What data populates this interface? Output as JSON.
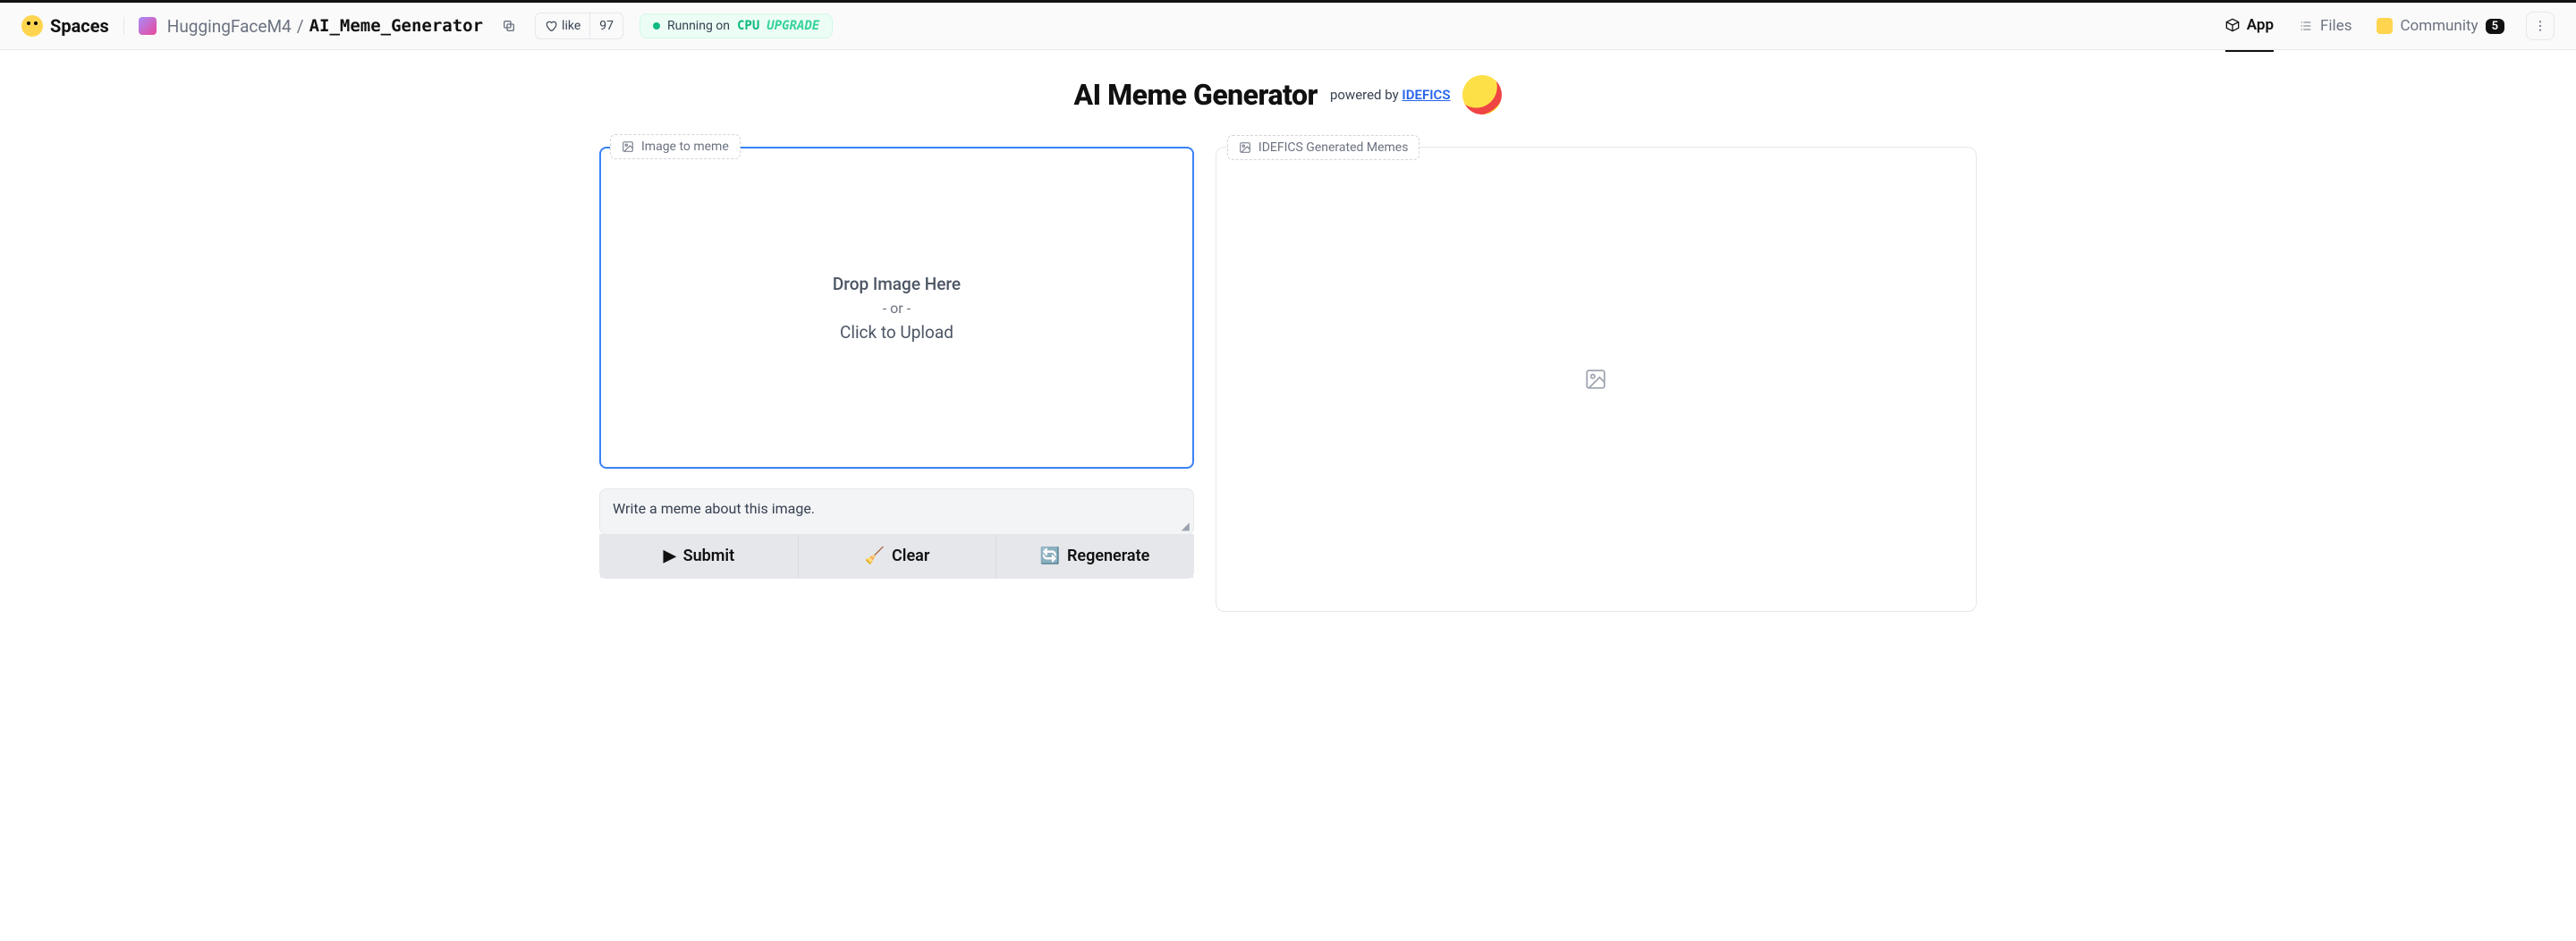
{
  "header": {
    "spaces_label": "Spaces",
    "owner": "HuggingFaceM4",
    "name": "AI_Meme_Generator",
    "like_label": "like",
    "like_count": "97",
    "status_prefix": "Running on",
    "status_cpu": "CPU",
    "status_upgrade": "UPGRADE"
  },
  "tabs": {
    "app": "App",
    "files": "Files",
    "community": "Community",
    "community_count": "5"
  },
  "hero": {
    "title": "AI Meme Generator",
    "powered_text": "powered by ",
    "powered_link": "IDEFICS"
  },
  "panels": {
    "input_label": "Image to meme",
    "output_label": "IDEFICS Generated Memes",
    "drop_line1": "Drop Image Here",
    "drop_or": "- or -",
    "drop_line2": "Click to Upload",
    "prompt_value": "Write a meme about this image."
  },
  "buttons": {
    "submit": "Submit",
    "clear": "Clear",
    "regenerate": "Regenerate"
  },
  "icons": {
    "submit": "▶",
    "clear": "🧹",
    "regenerate": "🔄"
  }
}
